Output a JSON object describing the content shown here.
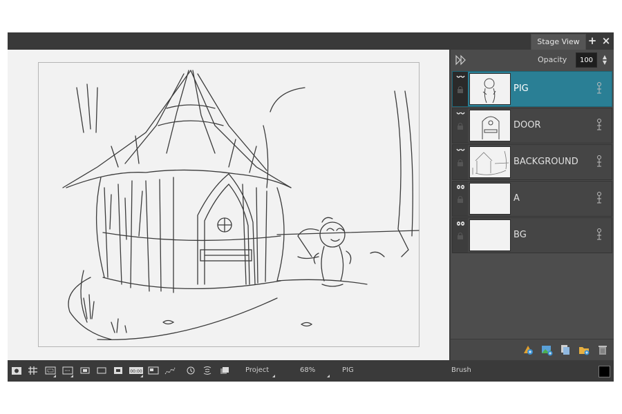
{
  "tabs": {
    "stage_view": "Stage View"
  },
  "panel": {
    "opacity_label": "Opacity",
    "opacity_value": "100"
  },
  "layers": [
    {
      "name": "PIG",
      "selected": true,
      "visible": true
    },
    {
      "name": "DOOR",
      "selected": false,
      "visible": true
    },
    {
      "name": "BACKGROUND",
      "selected": false,
      "visible": true
    },
    {
      "name": "A",
      "selected": false,
      "visible": true
    },
    {
      "name": "BG",
      "selected": false,
      "visible": true
    }
  ],
  "statusbar": {
    "view_mode": "Project",
    "zoom": "68%",
    "current_layer": "PIG",
    "tool": "Brush",
    "color": "#000000"
  },
  "colors": {
    "accent_selected": "#2a7f95",
    "panel_bg": "#4d4d4d",
    "canvas_bg": "#f2f2f2"
  },
  "icons": {
    "topbar": [
      "add-tab-icon",
      "close-tab-icon"
    ],
    "panel_head": "play-icon",
    "panel_footer": [
      "add-drawing-layer-icon",
      "add-bitmap-layer-icon",
      "duplicate-layer-icon",
      "add-folder-icon",
      "delete-layer-icon"
    ],
    "statusbar": [
      "camera-icon",
      "grid-icon",
      "safe-area-icon",
      "field-guide-icon",
      "frame-icon",
      "frame-outline-icon",
      "stop-icon",
      "timecode-icon",
      "image-icon",
      "tension-icon",
      "rotate-icon",
      "flip-icon",
      "onion-skin-icon"
    ]
  }
}
